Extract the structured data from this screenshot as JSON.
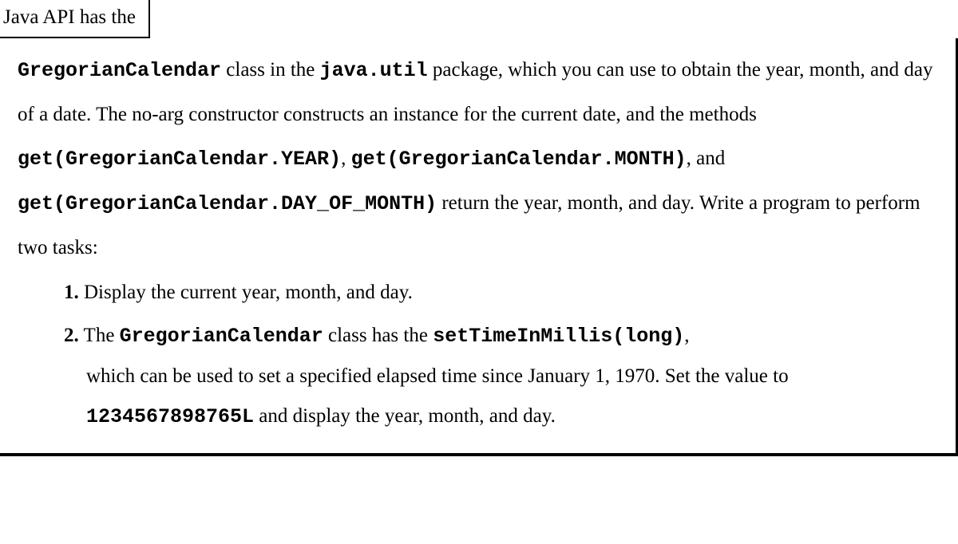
{
  "header": {
    "lead": "Java API has the"
  },
  "body": {
    "p1_seg1": " class in the ",
    "p1_code1": "GregorianCalendar",
    "p1_code2": "java.util",
    "p1_seg2": " package, which you can use to obtain the year, month, and day of a date. The no-arg constructor constructs an instance for the current date, and the methods ",
    "p1_code3": "get(GregorianCalendar.YEAR)",
    "p1_seg3": ", ",
    "p1_code4": "get(GregorianCalendar.MONTH)",
    "p1_seg4": ", and ",
    "p1_code5": "get(GregorianCalendar.DAY_OF_MONTH)",
    "p1_seg5": " return the year, month, and day. Write a program to perform two tasks:"
  },
  "tasks": [
    {
      "num": "1.",
      "seg1": " Display the current year, month, and day."
    },
    {
      "num": "2.",
      "seg1": " The ",
      "code1": "GregorianCalendar",
      "seg2": " class has the ",
      "code2": "setTimeInMillis(long)",
      "seg3": ", which can be used to set a specified elapsed time since January 1, 1970. Set the value to ",
      "code3": "1234567898765L",
      "seg4": " and display the year, month, and day."
    }
  ]
}
